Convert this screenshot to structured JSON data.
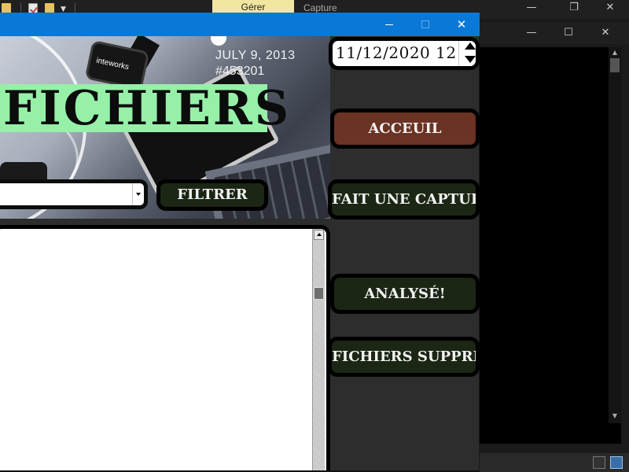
{
  "ribbon": {
    "tab_manage": "Gérer",
    "tab_capture": "Capture"
  },
  "banner": {
    "date": "JULY 9, 2013",
    "tag": "#453201",
    "watch_text": "inteworks"
  },
  "app": {
    "title": "FICHIERS",
    "date_picker_value": "11/12/2020 12",
    "filter_button": "FILTRER",
    "combo_value": "",
    "nav": {
      "home": "ACCEUIL",
      "capture": "FAIT UNE CAPTURE",
      "analyse": "ANALYSÉ!",
      "deleted": "FICHIERS SUPPRIMES"
    }
  },
  "files_list": [],
  "colors": {
    "titlebar": "#0a78d7",
    "title_bg": "#96f0a8",
    "home_button": "#6a3324",
    "nav_button": "#1c2614",
    "window_bg": "#2d2d2d"
  }
}
